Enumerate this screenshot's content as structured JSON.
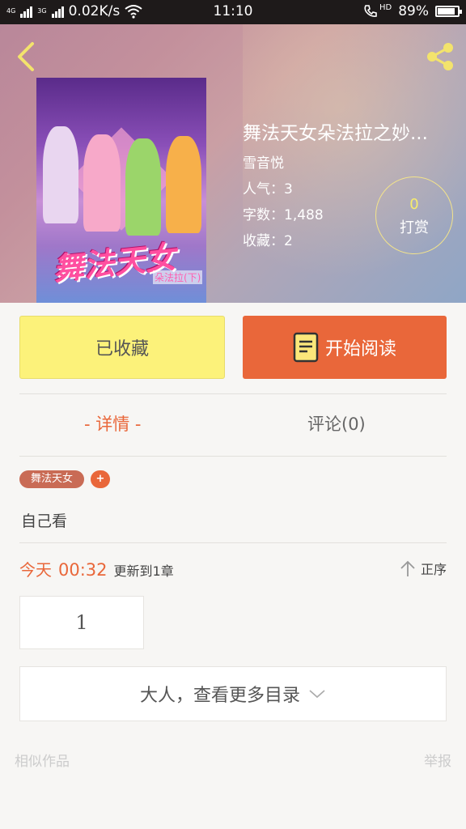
{
  "status_bar": {
    "net_labels": [
      "4G",
      "3G"
    ],
    "speed": "0.02K/s",
    "time": "11:10",
    "hd": "HD",
    "battery": "89%",
    "battery_level": 0.89
  },
  "header": {
    "book_title": "舞法天女朵法拉之妙...",
    "author": "雪音悦",
    "popularity": "人气：3",
    "word_count": "字数：1,488",
    "favorites": "收藏：2",
    "reward_count": "0",
    "reward_label": "打赏",
    "cover_logo": "舞法天女",
    "cover_sub": "朵法拉(下)"
  },
  "actions": {
    "favorited_label": "已收藏",
    "read_label": "开始阅读"
  },
  "tabs": {
    "detail": "- 详情 -",
    "comments": "评论(0)"
  },
  "tags": {
    "tag1": "舞法天女",
    "add": "+"
  },
  "description": "自己看",
  "update": {
    "today": "今天",
    "time": "00:32",
    "text": "更新到1章",
    "sort": "正序"
  },
  "chapters": {
    "first": "1",
    "more": "大人，查看更多目录"
  },
  "footer": {
    "similar": "相似作品",
    "report": "举报"
  },
  "colors": {
    "accent": "#e9673a",
    "favorite_bg": "#fcf27a",
    "reward_num": "#f7ec6c"
  }
}
